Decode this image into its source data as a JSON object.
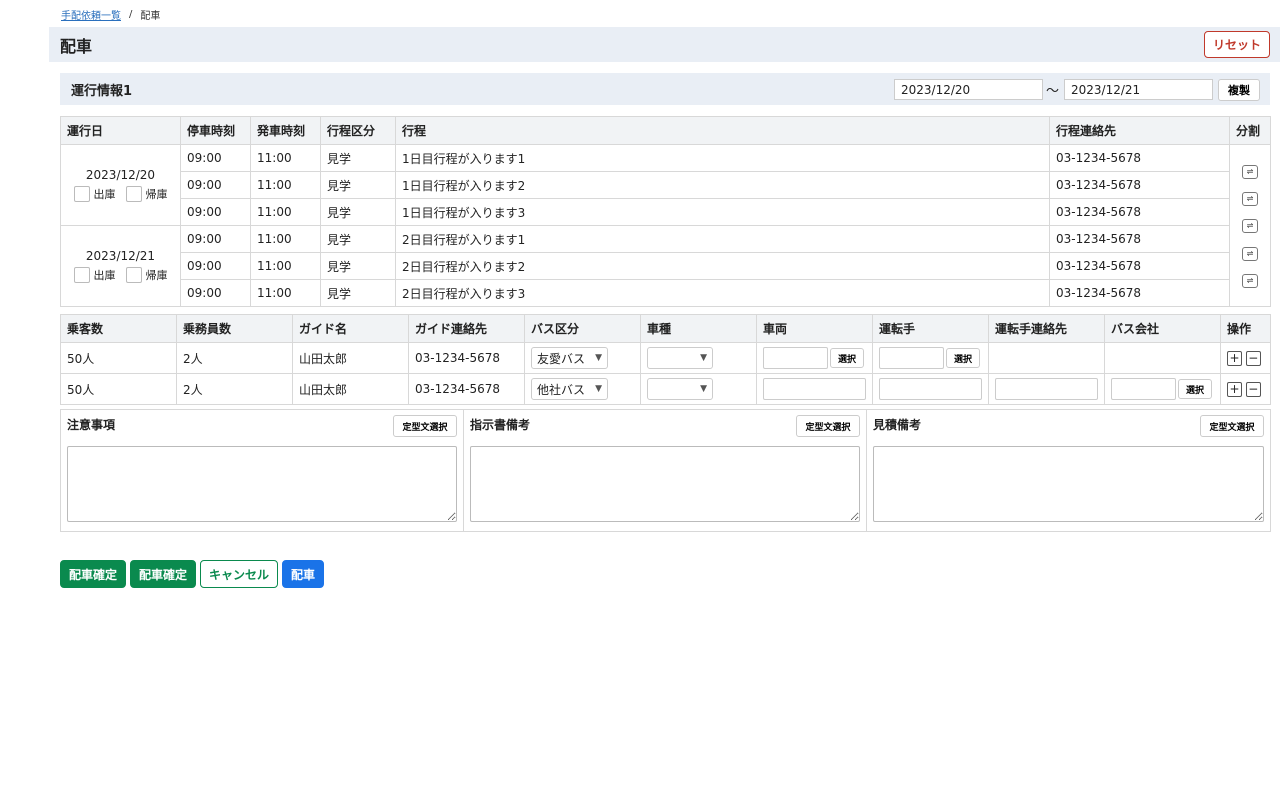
{
  "breadcrumb": {
    "parent": "手配依頼一覧",
    "separator": "/",
    "current": "配車"
  },
  "page": {
    "title": "配車",
    "reset_label": "リセット"
  },
  "section": {
    "title": "運行情報1",
    "date_from": "2023/12/20",
    "tilde": "〜",
    "date_to": "2023/12/21",
    "copy_label": "複製"
  },
  "schedule": {
    "headers": [
      "運行日",
      "停車時刻",
      "発車時刻",
      "行程区分",
      "行程",
      "行程連絡先",
      "分割"
    ],
    "checkbox_labels": {
      "out": "出庫",
      "return": "帰庫"
    },
    "days": [
      {
        "date": "2023/12/20",
        "rows": [
          {
            "stop": "09:00",
            "depart": "11:00",
            "type": "見学",
            "desc": "1日目行程が入ります1",
            "contact": "03-1234-5678"
          },
          {
            "stop": "09:00",
            "depart": "11:00",
            "type": "見学",
            "desc": "1日目行程が入ります2",
            "contact": "03-1234-5678"
          },
          {
            "stop": "09:00",
            "depart": "11:00",
            "type": "見学",
            "desc": "1日目行程が入ります3",
            "contact": "03-1234-5678"
          }
        ]
      },
      {
        "date": "2023/12/21",
        "rows": [
          {
            "stop": "09:00",
            "depart": "11:00",
            "type": "見学",
            "desc": "2日目行程が入ります1",
            "contact": "03-1234-5678"
          },
          {
            "stop": "09:00",
            "depart": "11:00",
            "type": "見学",
            "desc": "2日目行程が入ります2",
            "contact": "03-1234-5678"
          },
          {
            "stop": "09:00",
            "depart": "11:00",
            "type": "見学",
            "desc": "2日目行程が入ります3",
            "contact": "03-1234-5678"
          }
        ]
      }
    ]
  },
  "crew": {
    "headers": [
      "乗客数",
      "乗務員数",
      "ガイド名",
      "ガイド連絡先",
      "バス区分",
      "車種",
      "車両",
      "運転手",
      "運転手連絡先",
      "バス会社",
      "操作"
    ],
    "pick_label": "選択",
    "rows": [
      {
        "passengers": "50人",
        "crew": "2人",
        "guide": "山田太郎",
        "guide_contact": "03-1234-5678",
        "bus_type": "友愛バス"
      },
      {
        "passengers": "50人",
        "crew": "2人",
        "guide": "山田太郎",
        "guide_contact": "03-1234-5678",
        "bus_type": "他社バス"
      }
    ]
  },
  "notes": {
    "template_label": "定型文選択",
    "fields": [
      {
        "label": "注意事項"
      },
      {
        "label": "指示書備考"
      },
      {
        "label": "見積備考"
      }
    ]
  },
  "actions": {
    "confirm1": "配車確定",
    "confirm2": "配車確定",
    "cancel": "キャンセル",
    "dispatch": "配車"
  }
}
